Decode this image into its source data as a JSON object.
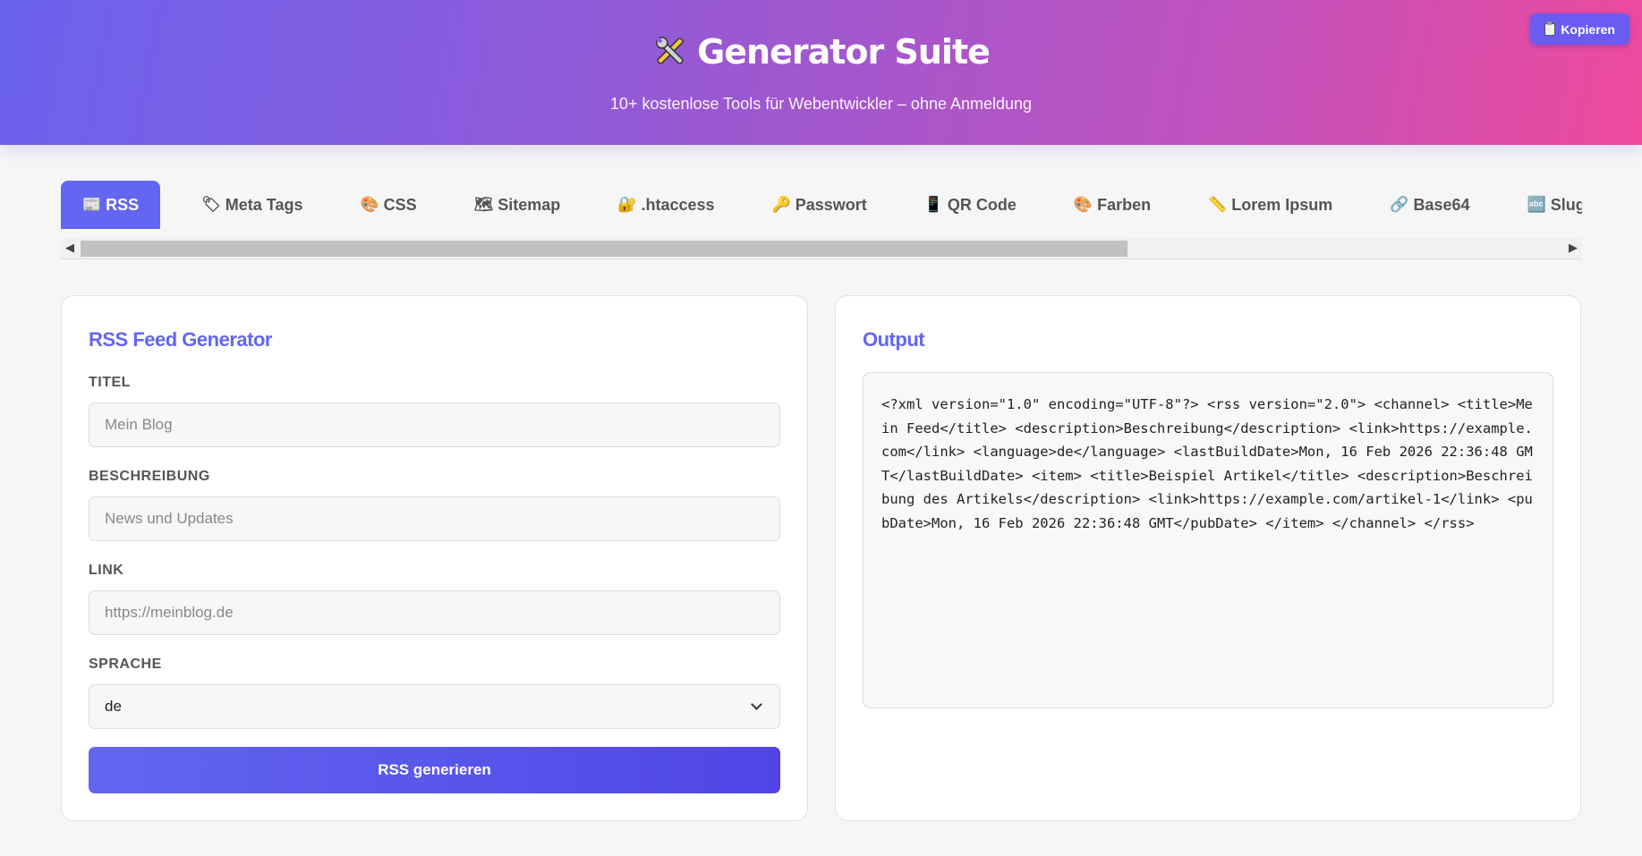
{
  "header": {
    "title": "Generator Suite",
    "tagline": "10+ kostenlose Tools für Webentwickler – ohne Anmeldung",
    "copy_button": "Kopieren"
  },
  "tabs": [
    {
      "icon": "📰",
      "label": "RSS",
      "active": true
    },
    {
      "icon": "🏷",
      "label": "Meta Tags"
    },
    {
      "icon": "🎨",
      "label": "CSS"
    },
    {
      "icon": "🗺",
      "label": "Sitemap"
    },
    {
      "icon": "🔐",
      "label": ".htaccess"
    },
    {
      "icon": "🔑",
      "label": "Passwort"
    },
    {
      "icon": "📱",
      "label": "QR Code"
    },
    {
      "icon": "🎨",
      "label": "Farben"
    },
    {
      "icon": "📏",
      "label": "Lorem Ipsum"
    },
    {
      "icon": "🔗",
      "label": "Base64"
    },
    {
      "icon": "🔤",
      "label": "Slug"
    },
    {
      "icon": "📐",
      "label": ""
    }
  ],
  "form": {
    "title": "RSS Feed Generator",
    "fields": {
      "title": {
        "label": "TITEL",
        "placeholder": "Mein Blog"
      },
      "description": {
        "label": "BESCHREIBUNG",
        "placeholder": "News und Updates"
      },
      "link": {
        "label": "LINK",
        "placeholder": "https://meinblog.de"
      },
      "language": {
        "label": "SPRACHE",
        "value": "de"
      }
    },
    "submit": "RSS generieren"
  },
  "output": {
    "title": "Output",
    "code": "<?xml version=\"1.0\" encoding=\"UTF-8\"?> <rss version=\"2.0\"> <channel> <title>Mein Feed</title> <description>Beschreibung</description> <link>https://example.com</link> <language>de</language> <lastBuildDate>Mon, 16 Feb 2026 22:36:48 GMT</lastBuildDate> <item> <title>Beispiel Artikel</title> <description>Beschreibung des Artikels</description> <link>https://example.com/artikel-1</link> <pubDate>Mon, 16 Feb 2026 22:36:48 GMT</pubDate> </item> </channel> </rss>"
  },
  "colors": {
    "accent": "#6366f1",
    "header_gradient_start": "#6a63ee",
    "header_gradient_end": "#ee4a9c"
  }
}
